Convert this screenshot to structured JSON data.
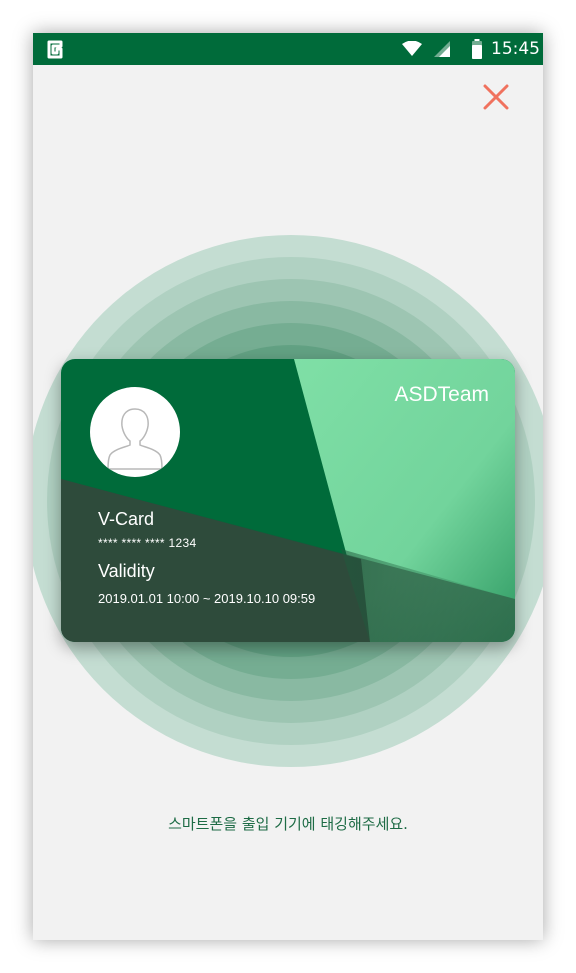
{
  "status_bar": {
    "time": "15:45",
    "app_icon": "app-logo-icon",
    "icons": [
      "wifi-icon",
      "signal-icon",
      "battery-icon"
    ]
  },
  "header": {
    "close_icon": "close-icon"
  },
  "card": {
    "team": "ASDTeam",
    "title": "V-Card",
    "number": "**** **** **** 1234",
    "validity_label": "Validity",
    "validity_value": "2019.01.01 10:00 ~ 2019.10.10 09:59",
    "avatar_icon": "user-avatar-icon"
  },
  "instruction": "스마트폰을 출입 기기에 태깅해주세요.",
  "colors": {
    "status_bar": "#006b3a",
    "close": "#f0725e",
    "card_dark": "#006b3a",
    "card_light": "#7ddba3",
    "text_green": "#1d6b45"
  }
}
